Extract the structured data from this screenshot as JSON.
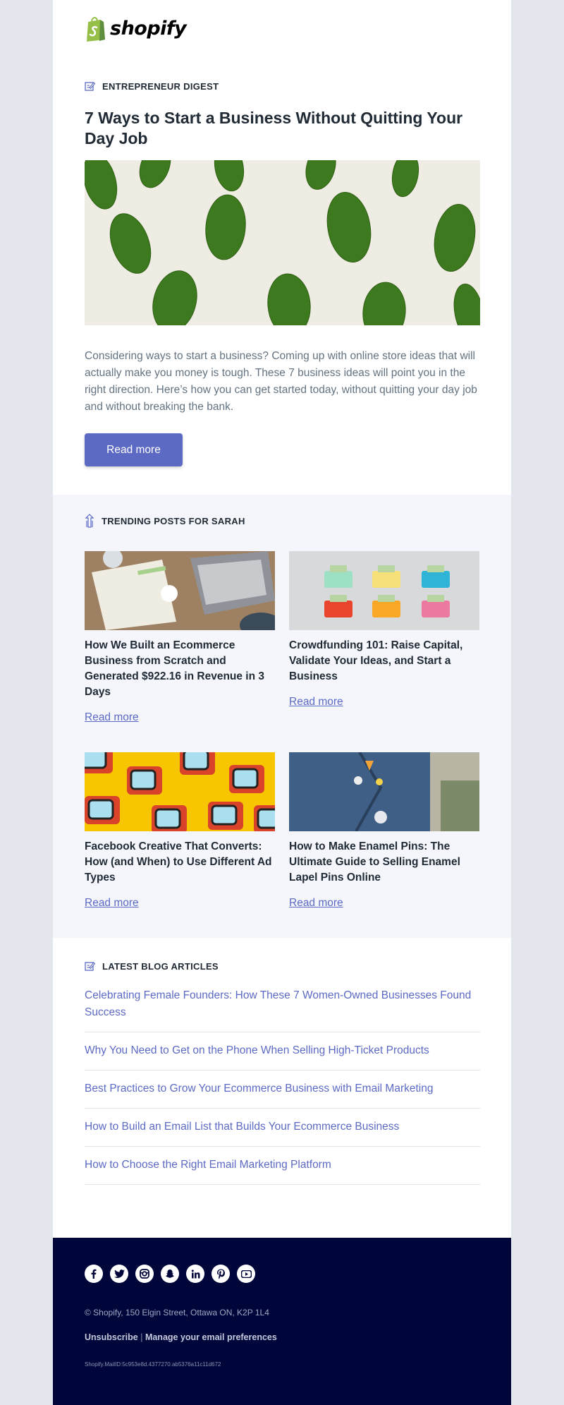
{
  "brand": {
    "name": "shopify"
  },
  "hero": {
    "section_label": "ENTREPRENEUR DIGEST",
    "title": "7 Ways to Start a Business Without Quitting Your Day Job",
    "body": "Considering ways to start a business? Coming up with online store ideas that will actually make you money is tough. These 7 business ideas will point you in the right direction. Here’s how you can get started today, without quitting your day job and without breaking the bank.",
    "cta": "Read more",
    "image_icon": "green-leaves-on-paper-image"
  },
  "trending": {
    "section_label": "TRENDING POSTS FOR SARAH",
    "posts": [
      {
        "title": "How We Built an Ecommerce Business from Scratch and Generated $922.16 in Revenue in 3 Days",
        "link": "Read more",
        "image_icon": "desk-laptop-image"
      },
      {
        "title": "Crowdfunding 101: Raise Capital, Validate Your Ideas, and Start a Business",
        "link": "Read more",
        "image_icon": "colorful-wallets-image"
      },
      {
        "title": "Facebook Creative That Converts: How (and When) to Use Different Ad Types",
        "link": "Read more",
        "image_icon": "retro-tvs-image"
      },
      {
        "title": "How to Make Enamel Pins: The Ultimate Guide to Selling Enamel Lapel Pins Online",
        "link": "Read more",
        "image_icon": "denim-jacket-pins-image"
      }
    ]
  },
  "latest": {
    "section_label": "LATEST BLOG ARTICLES",
    "articles": [
      "Celebrating Female Founders: How These 7 Women-Owned Businesses Found Success",
      "Why You Need to Get on the Phone When Selling High-Ticket Products",
      "Best Practices to Grow Your Ecommerce Business with Email Marketing",
      "How to Build an Email List that Builds Your Ecommerce Business",
      "How to Choose the Right Email Marketing Platform"
    ]
  },
  "footer": {
    "social": [
      "facebook-icon",
      "twitter-icon",
      "instagram-icon",
      "snapchat-icon",
      "linkedin-icon",
      "pinterest-icon",
      "youtube-icon"
    ],
    "address": "© Shopify,  150 Elgin Street, Ottawa ON, K2P 1L4",
    "unsubscribe": "Unsubscribe",
    "separator": "|",
    "manage": "Manage your email preferences",
    "mail_id": "Shopify.MailID:5c953e8d.4377270.ab5376a11c11d672"
  },
  "colors": {
    "accent": "#5c6ac4",
    "footer_bg": "#000639",
    "trending_bg": "#f4f6fb",
    "page_bg": "#e3e6ec",
    "text_dark": "#212b36",
    "text_muted": "#637381"
  }
}
